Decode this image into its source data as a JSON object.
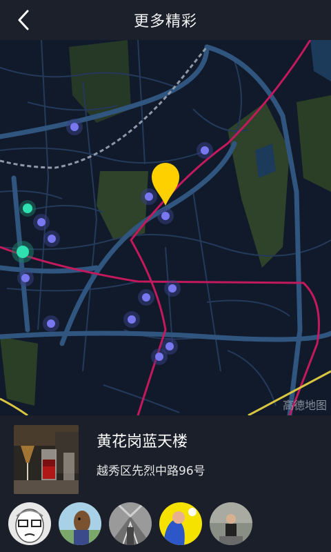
{
  "header": {
    "title": "更多精彩",
    "back_icon": "chevron-left-icon"
  },
  "map": {
    "watermark": "高德地图",
    "marker_icon": "location-pin-icon",
    "colors": {
      "background": "#111a2a",
      "road": "#2f4a6a",
      "main_road": "#3b6ea0",
      "metro": "#c3195d",
      "park": "#2d3f2a",
      "poi": "#7a78f0",
      "poi_active": "#2fe0b0",
      "pin": "#ffd000"
    }
  },
  "place": {
    "name": "黄花岗蓝天楼",
    "address": "越秀区先烈中路96号"
  },
  "avatars": [
    {
      "name": "avatar-cartoon-face"
    },
    {
      "name": "avatar-horse-character"
    },
    {
      "name": "avatar-building"
    },
    {
      "name": "avatar-yellow-illustration"
    },
    {
      "name": "avatar-person-photo"
    }
  ]
}
